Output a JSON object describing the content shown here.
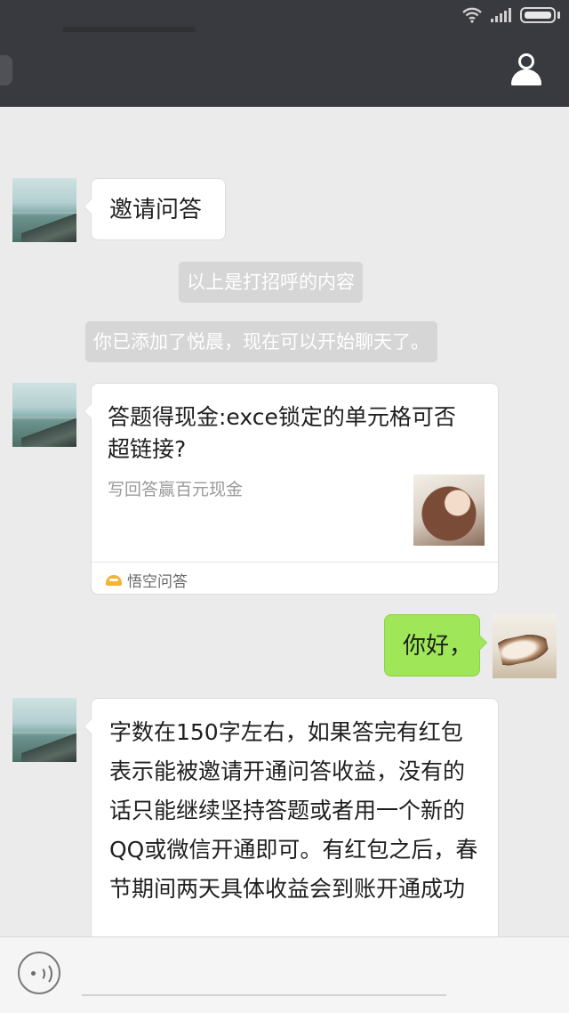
{
  "status_bar": {
    "wifi_icon": "wifi-icon",
    "signal_icon": "signal-icon",
    "battery_icon": "battery-icon"
  },
  "nav": {
    "profile_icon": "person-icon"
  },
  "messages": [
    {
      "from": "contact",
      "type": "text",
      "text": "邀请问答"
    },
    {
      "type": "system",
      "text": "以上是打招呼的内容"
    },
    {
      "type": "system",
      "text": "你已添加了悦晨，现在可以开始聊天了。"
    },
    {
      "from": "contact",
      "type": "card",
      "title": "答题得现金:exce锁定的单元格可否超链接?",
      "description": "写回答赢百元现金",
      "source": "悟空问答"
    },
    {
      "from": "me",
      "type": "text",
      "text": "你好，"
    },
    {
      "from": "contact",
      "type": "text",
      "text": "字数在150字左右，如果答完有红包表示能被邀请开通问答收益，没有的话只能继续坚持答题或者用一个新的QQ或微信开通即可。有红包之后，春节期间两天具体收益会到账开通成功"
    }
  ],
  "input_bar": {
    "voice_icon": "voice-icon",
    "placeholder": ""
  },
  "colors": {
    "nav_bg": "#393a3f",
    "chat_bg": "#ebebeb",
    "my_bubble": "#9fe658",
    "system_bg": "#d6d6d6"
  }
}
